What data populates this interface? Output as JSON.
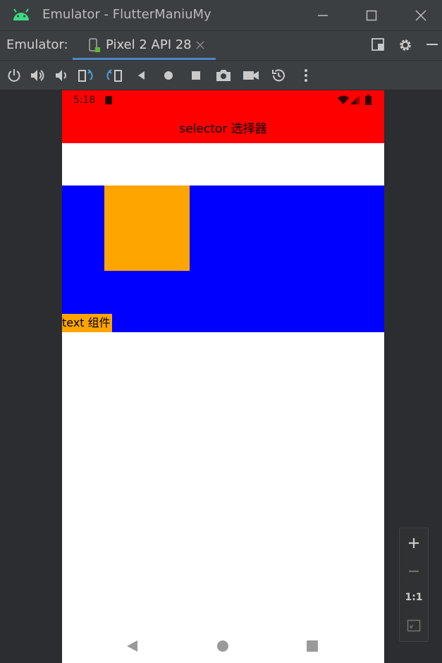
{
  "window": {
    "title": "Emulator - FlutterManiuMy",
    "controls": [
      "minimize-icon",
      "maximize-icon",
      "close-icon"
    ]
  },
  "tabbar": {
    "label": "Emulator:",
    "active_tab": "Pixel 2 API 28",
    "right_icons": [
      "window-mode-icon",
      "gear-icon",
      "minimize-panel-icon"
    ]
  },
  "toolbar": {
    "icons": [
      "power-icon",
      "volume-up-icon",
      "volume-down-icon",
      "rotate-left-icon",
      "rotate-right-icon",
      "back-icon",
      "home-icon",
      "overview-icon",
      "screenshot-icon",
      "screen-record-icon",
      "snapshot-icon",
      "more-icon"
    ]
  },
  "device": {
    "status_time": "5:18",
    "app_title": "selector 选择器",
    "text_chip": "text 组件",
    "colors": {
      "status": "#ff0000",
      "appbar": "#ff0000",
      "container": "#0000ff",
      "box": "#ffa500",
      "chip": "#ffa500"
    }
  },
  "zoom": {
    "one_to_one": "1:1",
    "icons": [
      "zoom-in-icon",
      "zoom-out-icon",
      "fit-screen-icon"
    ]
  }
}
